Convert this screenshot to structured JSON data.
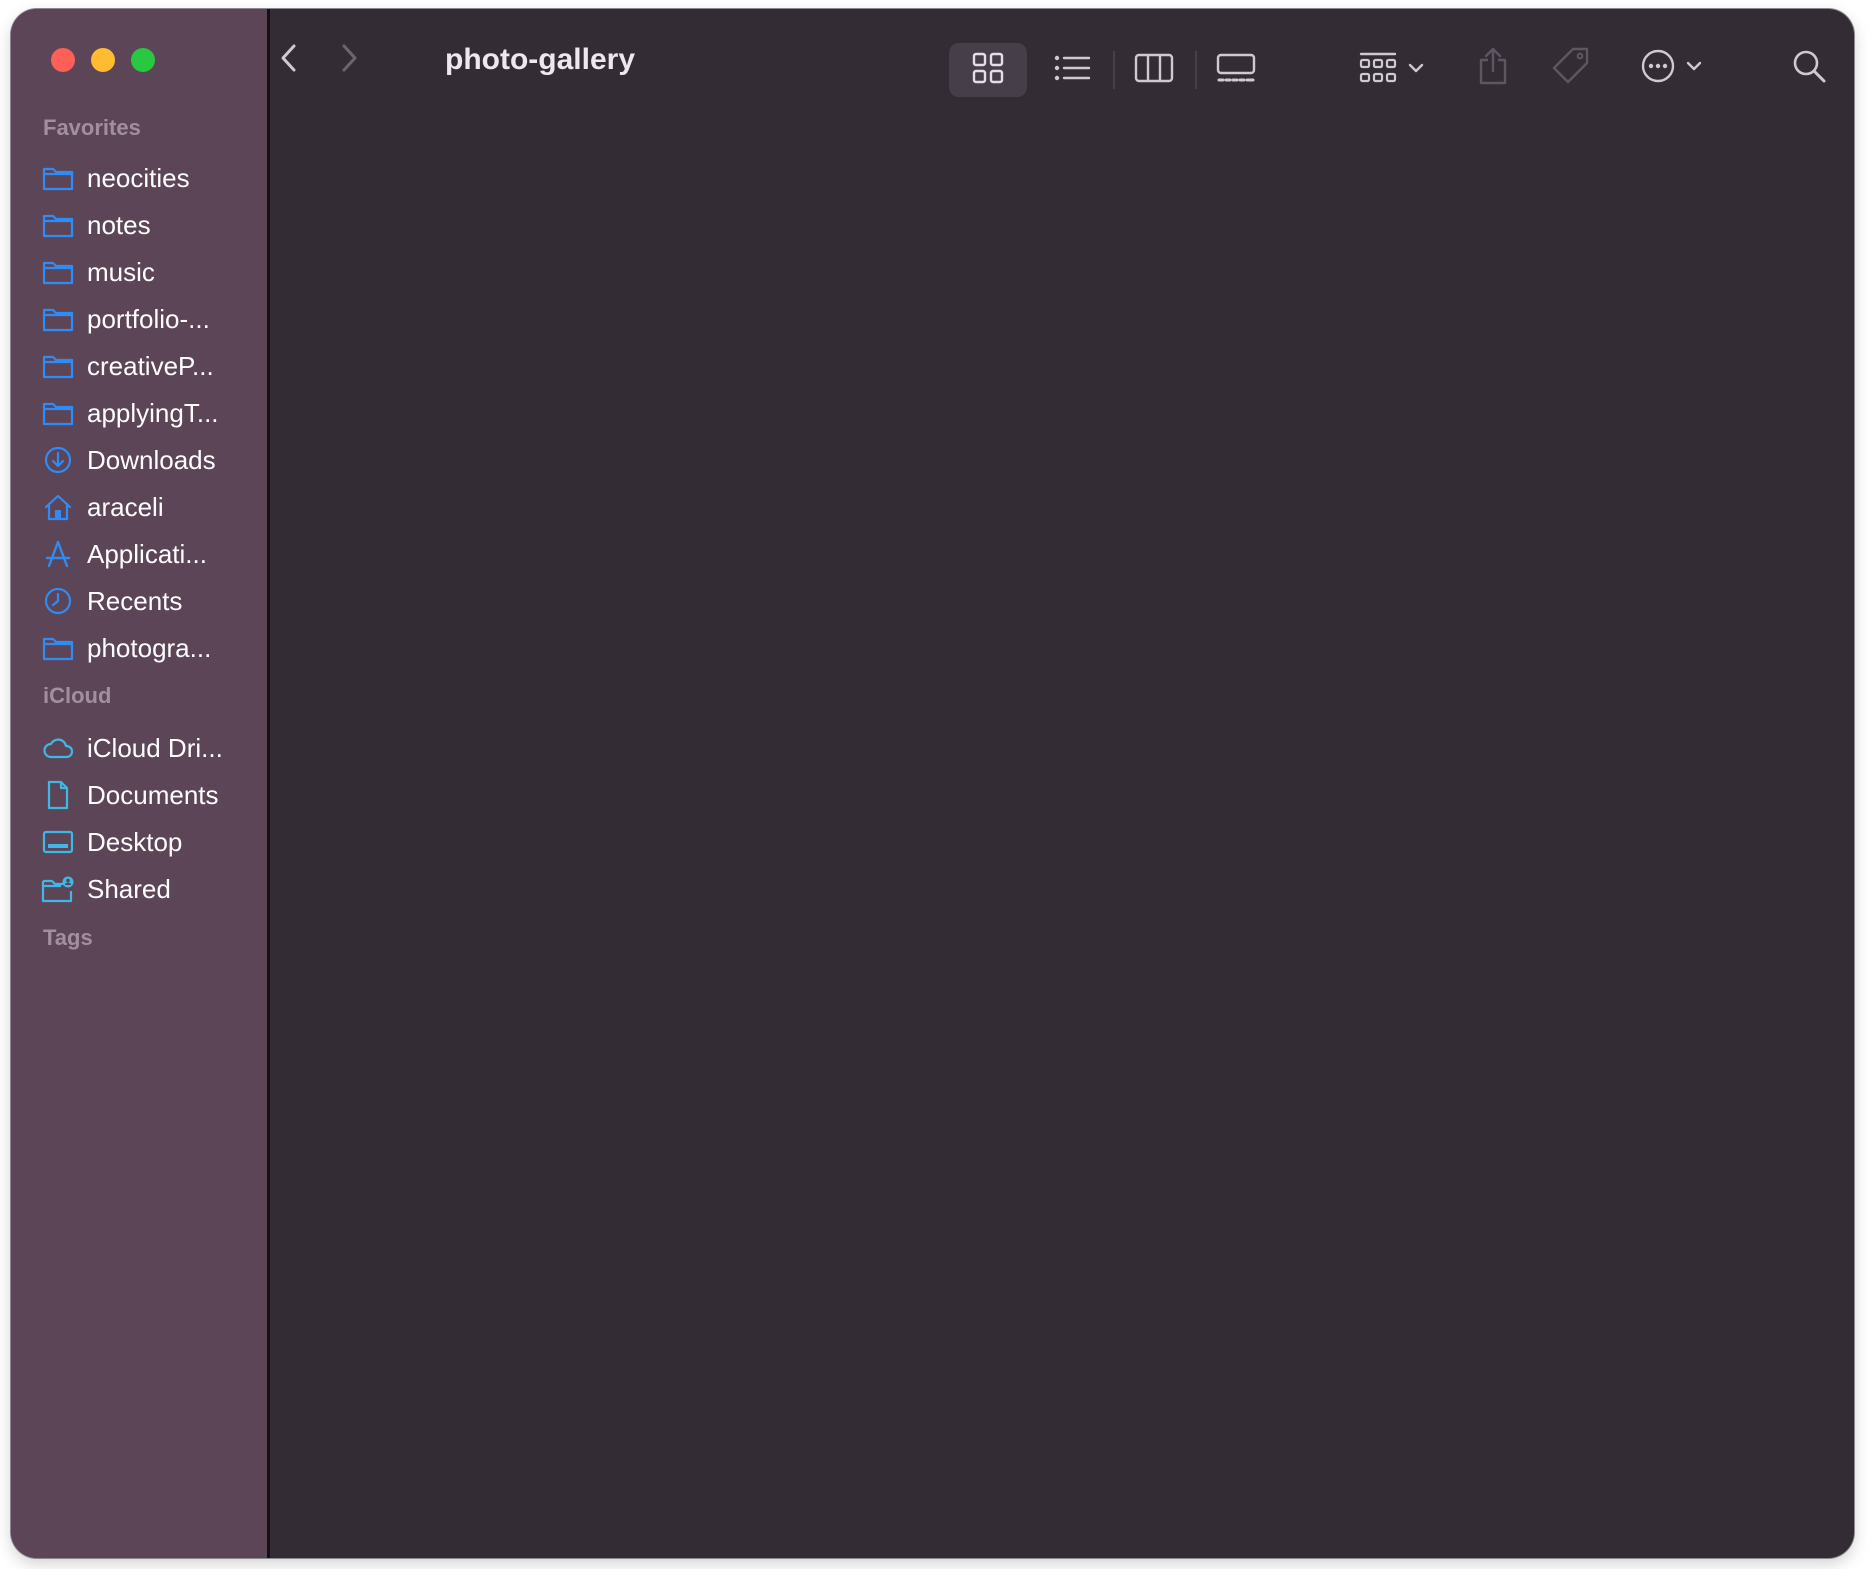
{
  "window": {
    "title": "photo-gallery"
  },
  "sidebar": {
    "favorites_label": "Favorites",
    "favorites": [
      {
        "label": "neocities",
        "icon": "folder-icon"
      },
      {
        "label": "notes",
        "icon": "folder-icon"
      },
      {
        "label": "music",
        "icon": "folder-icon"
      },
      {
        "label": "portfolio-...",
        "icon": "folder-icon"
      },
      {
        "label": "creativeP...",
        "icon": "folder-icon"
      },
      {
        "label": "applyingT...",
        "icon": "folder-icon"
      },
      {
        "label": "Downloads",
        "icon": "download-circle-icon"
      },
      {
        "label": "araceli",
        "icon": "home-icon"
      },
      {
        "label": "Applicati...",
        "icon": "applications-icon"
      },
      {
        "label": "Recents",
        "icon": "clock-icon"
      },
      {
        "label": "photogra...",
        "icon": "folder-icon"
      }
    ],
    "icloud_label": "iCloud",
    "icloud": [
      {
        "label": "iCloud Dri...",
        "icon": "cloud-icon"
      },
      {
        "label": "Documents",
        "icon": "document-icon"
      },
      {
        "label": "Desktop",
        "icon": "desktop-icon"
      },
      {
        "label": "Shared",
        "icon": "shared-folder-icon"
      }
    ],
    "tags_label": "Tags"
  },
  "toolbar": {
    "active_view": "icon-view",
    "icons": [
      "back-chevron-icon",
      "forward-chevron-icon",
      "icon-grid-view-icon",
      "list-view-icon",
      "column-view-icon",
      "gallery-view-icon",
      "group-by-icon",
      "share-icon",
      "tag-icon",
      "more-actions-icon",
      "search-icon"
    ]
  },
  "colors": {
    "sidebar_bg": "#5d4558",
    "content_bg": "#332c35",
    "accent_blue": "#2f8cf5",
    "accent_cyan": "#3fb8e8",
    "close": "#fe5f57",
    "minimize": "#febc2e",
    "maximize": "#28c840"
  }
}
